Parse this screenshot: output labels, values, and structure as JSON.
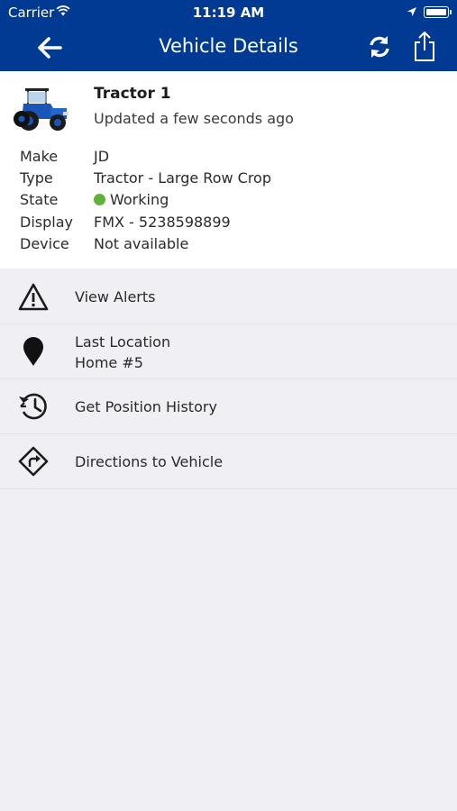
{
  "status_bar": {
    "carrier": "Carrier",
    "time": "11:19 AM"
  },
  "nav": {
    "title": "Vehicle Details",
    "back_icon": "back-arrow-icon",
    "refresh_icon": "refresh-icon",
    "share_icon": "share-icon"
  },
  "vehicle": {
    "name": "Tractor 1",
    "updated": "Updated a few seconds ago",
    "details": [
      {
        "key": "Make",
        "value": "JD"
      },
      {
        "key": "Type",
        "value": "Tractor - Large Row Crop"
      },
      {
        "key": "State",
        "value": "Working"
      },
      {
        "key": "Display",
        "value": "FMX - 5238598899"
      },
      {
        "key": "Device",
        "value": "Not available"
      }
    ],
    "state_color": "#5fb13a"
  },
  "actions": [
    {
      "label": "View Alerts",
      "icon": "warning-icon"
    },
    {
      "label": "Last Location",
      "sub": "Home #5",
      "icon": "location-pin-icon"
    },
    {
      "label": "Get Position History",
      "icon": "history-icon"
    },
    {
      "label": "Directions to Vehicle",
      "icon": "directions-icon"
    }
  ],
  "colors": {
    "header": "#003a93",
    "background": "#efeff4"
  }
}
